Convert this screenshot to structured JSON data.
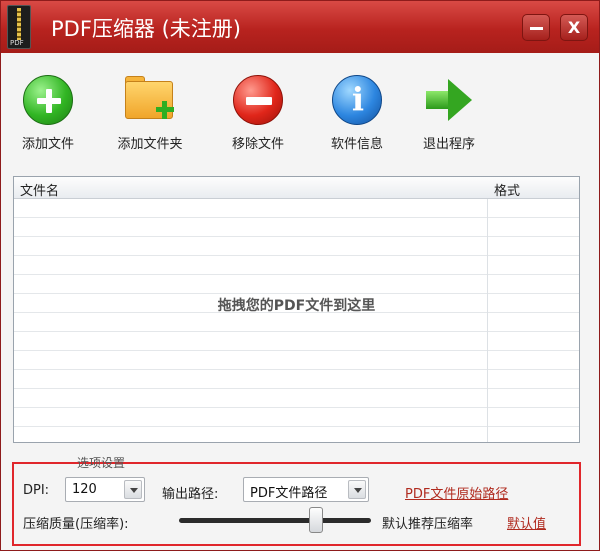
{
  "window": {
    "title": "PDF压缩器 (未注册)",
    "icon_text": "PDF",
    "minimize_icon": "minimize-icon",
    "close_icon": "close-icon",
    "close_glyph": "X"
  },
  "toolbar": {
    "items": [
      {
        "label": "添加文件",
        "icon": "add-file-icon"
      },
      {
        "label": "添加文件夹",
        "icon": "add-folder-icon"
      },
      {
        "label": "移除文件",
        "icon": "remove-icon"
      },
      {
        "label": "软件信息",
        "icon": "info-icon"
      },
      {
        "label": "退出程序",
        "icon": "exit-arrow-icon"
      }
    ]
  },
  "file_list": {
    "columns": [
      "文件名",
      "格式"
    ],
    "drop_hint": "拖拽您的PDF文件到这里",
    "rows": []
  },
  "options": {
    "section_label": "选项设置",
    "dpi_label": "DPI:",
    "dpi_value": "120",
    "output_path_label": "输出路径:",
    "output_path_value": "PDF文件路径",
    "original_path_link": "PDF文件原始路径",
    "quality_label": "压缩质量(压缩率):",
    "quality_level": 0.73,
    "recommended_text": "默认推荐压缩率",
    "default_link": "默认值"
  },
  "colors": {
    "titlebar": "#c0302b",
    "highlight_border": "#e0262b",
    "link": "#b02a1e"
  }
}
